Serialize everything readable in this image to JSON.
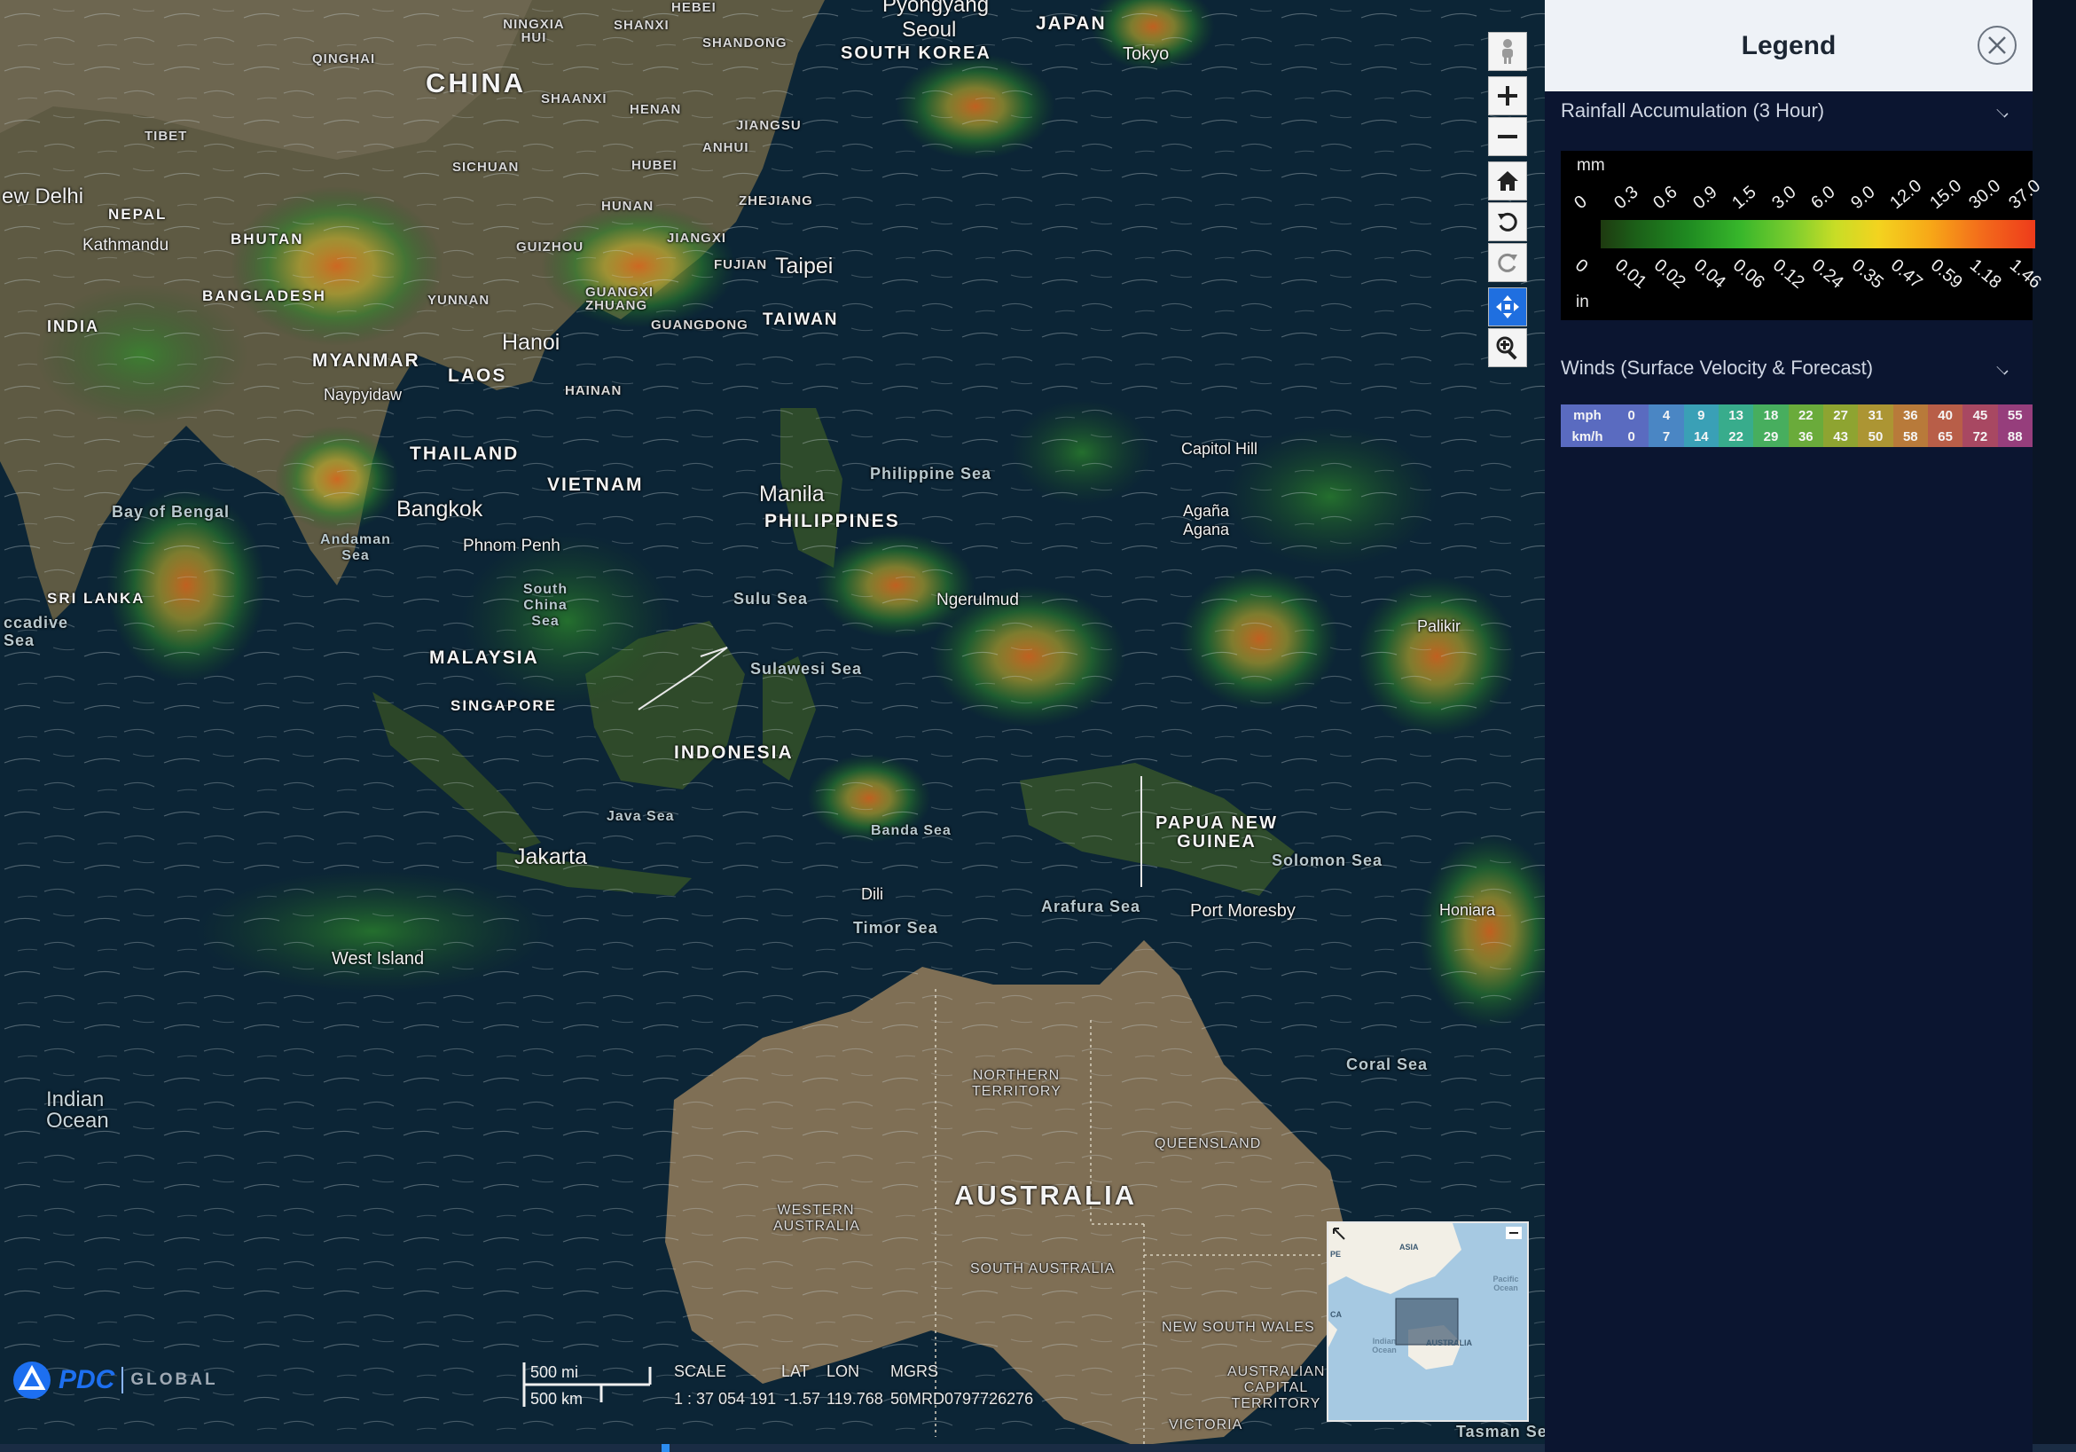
{
  "map": {
    "countries": [
      "CHINA",
      "INDIA",
      "NEPAL",
      "BHUTAN",
      "BANGLADESH",
      "MYANMAR",
      "LAOS",
      "THAILAND",
      "VIETNAM",
      "MALAYSIA",
      "SINGAPORE",
      "INDONESIA",
      "PHILIPPINES",
      "TAIWAN",
      "SOUTH KOREA",
      "JAPAN",
      "SRI LANKA",
      "PAPUA NEW GUINEA",
      "AUSTRALIA"
    ],
    "provinces": [
      "QINGHAI",
      "NINGXIA HUI",
      "SHANXI",
      "HEBEI",
      "SHANDONG",
      "SHAANXI",
      "HENAN",
      "JIANGSU",
      "ANHUI",
      "TIBET",
      "SICHUAN",
      "HUBEI",
      "ZHEJIANG",
      "HUNAN",
      "JIANGXI",
      "FUJIAN",
      "GUIZHOU",
      "GUANGXI ZHUANG",
      "GUANGDONG",
      "YUNNAN",
      "HAINAN"
    ],
    "cities": [
      "Pyongyang",
      "Seoul",
      "Tokyo",
      "ew Delhi",
      "Kathmandu",
      "Taipei",
      "Hanoi",
      "Naypyidaw",
      "Bangkok",
      "Phnom Penh",
      "Manila",
      "Ngerulmud",
      "Capitol Hill",
      "Agaña Agana",
      "Palikir",
      "Jakarta",
      "West Island",
      "Dili",
      "Port Moresby",
      "Honiara"
    ],
    "seas": [
      "Bay of Bengal",
      "Andaman Sea",
      "South China Sea",
      "Philippine Sea",
      "Sulu Sea",
      "Sulawesi Sea",
      "Java Sea",
      "Banda Sea",
      "Timor Sea",
      "Arafura Sea",
      "Solomon Sea",
      "Coral Sea",
      "Tasman Se",
      "ccadive Sea"
    ],
    "ocean": "Indian Ocean",
    "regions": [
      "NORTHERN TERRITORY",
      "QUEENSLAND",
      "WESTERN AUSTRALIA",
      "SOUTH AUSTRALIA",
      "NEW SOUTH WALES",
      "AUSTRALIAN CAPITAL TERRITORY",
      "VICTORIA"
    ]
  },
  "toolbar": {
    "buttons": [
      "pegman-icon",
      "zoom-in-icon",
      "zoom-out-icon",
      "home-icon",
      "rotate-left-icon",
      "rotate-right-icon",
      "pan-icon",
      "zoom-region-icon"
    ],
    "active": "pan-icon"
  },
  "overview": {
    "labels": [
      "ASIA",
      "Pacific Ocean",
      "Indian Ocean",
      "AUSTRALIA",
      "PE",
      "CA"
    ]
  },
  "logo": {
    "brand": "PDC",
    "suffix": "GLOBAL"
  },
  "scale": {
    "mi": "500 mi",
    "km": "500 km"
  },
  "readout": {
    "scale_label": "SCALE",
    "scale_value": "1 : 37 054 191",
    "lat_label": "LAT",
    "lat_value": "-1.57",
    "lon_label": "LON",
    "lon_value": "119.768",
    "mgrs_label": "MGRS",
    "mgrs_value": "50MRD0797726276"
  },
  "legend": {
    "title": "Legend",
    "rain": {
      "title": "Rainfall Accumulation (3 Hour)",
      "unit_mm": "mm",
      "unit_in": "in",
      "mm_ticks": [
        "0",
        "0.3",
        "0.6",
        "0.9",
        "1.5",
        "3.0",
        "6.0",
        "9.0",
        "12.0",
        "15.0",
        "30.0",
        "37.0"
      ],
      "in_ticks": [
        "0",
        "0.01",
        "0.02",
        "0.04",
        "0.06",
        "0.12",
        "0.24",
        "0.35",
        "0.47",
        "0.59",
        "1.18",
        "1.46"
      ]
    },
    "winds": {
      "title": "Winds (Surface Velocity & Forecast)",
      "mph_label": "mph",
      "kmh_label": "km/h",
      "mph": [
        "0",
        "4",
        "9",
        "13",
        "18",
        "22",
        "27",
        "31",
        "36",
        "40",
        "45",
        "55"
      ],
      "kmh": [
        "0",
        "7",
        "14",
        "22",
        "29",
        "36",
        "43",
        "50",
        "58",
        "65",
        "72",
        "88"
      ],
      "colors": [
        "#5a6bc0",
        "#4a86c4",
        "#3aa0b6",
        "#38ac8c",
        "#47ae5e",
        "#6aab3b",
        "#8ea431",
        "#ac9533",
        "#b87a3a",
        "#b85e48",
        "#a84862",
        "#963e7c"
      ]
    }
  }
}
